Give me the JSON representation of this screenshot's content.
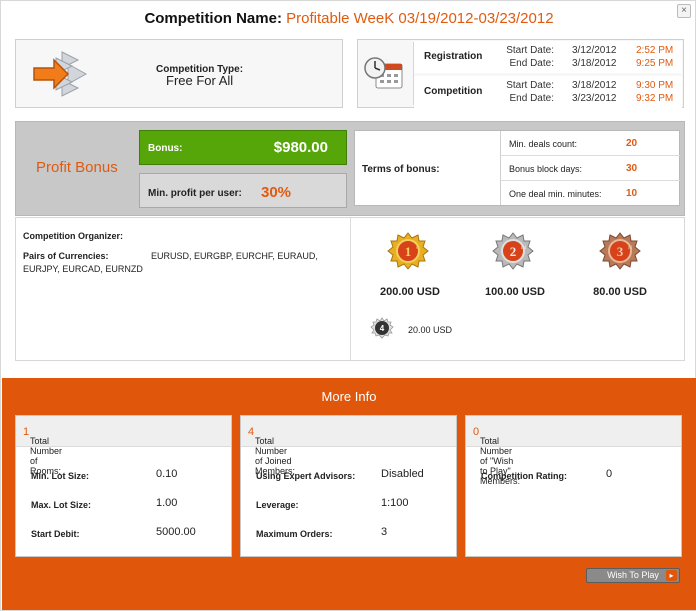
{
  "header": {
    "title_label": "Competition Name:",
    "title_value": "Profitable WeeK 03/19/2012-03/23/2012",
    "close_glyph": "×"
  },
  "competition_type": {
    "label": "Competition Type:",
    "value": "Free For All",
    "icon": "arrow-icon"
  },
  "dates": {
    "icon": "calendar-clock-icon",
    "registration": {
      "name": "Registration",
      "start_label": "Start Date:",
      "start_date": "3/12/2012",
      "start_time": "2:52 PM",
      "end_label": "End Date:",
      "end_date": "3/18/2012",
      "end_time": "9:25 PM"
    },
    "competition": {
      "name": "Competition",
      "start_label": "Start Date:",
      "start_date": "3/18/2012",
      "start_time": "9:30 PM",
      "end_label": "End Date:",
      "end_date": "3/23/2012",
      "end_time": "9:32 PM"
    }
  },
  "bonus": {
    "section_label": "Profit Bonus",
    "bonus_label": "Bonus:",
    "bonus_value": "$980.00",
    "min_profit_label": "Min. profit per user:",
    "min_profit_value": "30%",
    "terms_label": "Terms of bonus:",
    "terms": [
      {
        "label": "Min. deals count:",
        "value": "20"
      },
      {
        "label": "Bonus block days:",
        "value": "30"
      },
      {
        "label": "One deal min. minutes:",
        "value": "10"
      }
    ]
  },
  "details": {
    "organizer_label": "Competition Organizer:",
    "pairs_label": "Pairs of Currencies:",
    "pairs_value_line1": "EURUSD, EURGBP, EURCHF, EURAUD,",
    "pairs_value_line2": "EURJPY, EURCAD, EURNZD"
  },
  "prizes": [
    {
      "place": "1",
      "suffix": "st",
      "amount": "200.00 USD",
      "icon": "gold-medal-icon"
    },
    {
      "place": "2",
      "suffix": "nd",
      "amount": "100.00 USD",
      "icon": "silver-medal-icon"
    },
    {
      "place": "3",
      "suffix": "rd",
      "amount": "80.00 USD",
      "icon": "bronze-medal-icon"
    },
    {
      "place": "4",
      "suffix": "",
      "amount": "20.00 USD",
      "icon": "fourth-place-icon"
    }
  ],
  "more_info": {
    "title": "More Info",
    "rooms_card": {
      "header_label": "Total Number of Rooms:",
      "header_value": "1",
      "rows": [
        {
          "label": "Min. Lot Size:",
          "value": "0.10"
        },
        {
          "label": "Max. Lot Size:",
          "value": "1.00"
        },
        {
          "label": "Start Debit:",
          "value": "5000.00"
        }
      ]
    },
    "members_card": {
      "header_label": "Total Number of Joined Members:",
      "header_value": "4",
      "rows": [
        {
          "label": "Using Expert Advisors:",
          "value": "Disabled"
        },
        {
          "label": "Leverage:",
          "value": "1:100"
        },
        {
          "label": "Maximum Orders:",
          "value": "3"
        }
      ]
    },
    "wish_card": {
      "header_label": "Total Number of \"Wish to Play\" Members:",
      "header_value": "0",
      "rows": [
        {
          "label": "Competition Rating:",
          "value": "0"
        }
      ]
    },
    "wish_button_label": "Wish To Play"
  },
  "colors": {
    "accent_orange": "#e05a10",
    "band_orange": "#e0560a",
    "bonus_green": "#56a60a",
    "gold": "#e0a21a",
    "silver": "#a6a6a6",
    "bronze": "#b06a45"
  }
}
